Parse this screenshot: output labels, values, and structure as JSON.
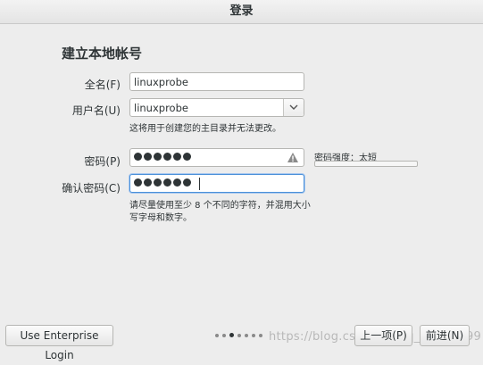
{
  "window": {
    "title": "登录"
  },
  "form": {
    "heading": "建立本地帐号",
    "fullname": {
      "label": "全名(F)",
      "value": "linuxprobe"
    },
    "username": {
      "label": "用户名(U)",
      "value": "linuxprobe",
      "hint": "这将用于创建您的主目录并无法更改。"
    },
    "password": {
      "label": "密码(P)",
      "masked_length": 6,
      "icon": "warning-icon"
    },
    "confirm": {
      "label": "确认密码(C)",
      "masked_length": 6
    },
    "strength": {
      "label": "密码强度：太短",
      "level": 0.0
    },
    "password_hint": [
      "请尽量使用至少 8 个不同的字符，并混用大小",
      "写字母和数字。"
    ]
  },
  "footer": {
    "enterprise_label": "Use Enterprise Login",
    "prev_label": "上一项(P)",
    "next_label": "前进(N)",
    "pager": {
      "total": 7,
      "current": 3
    }
  },
  "watermark": "https://blog.csdn.net/qq_41591099"
}
